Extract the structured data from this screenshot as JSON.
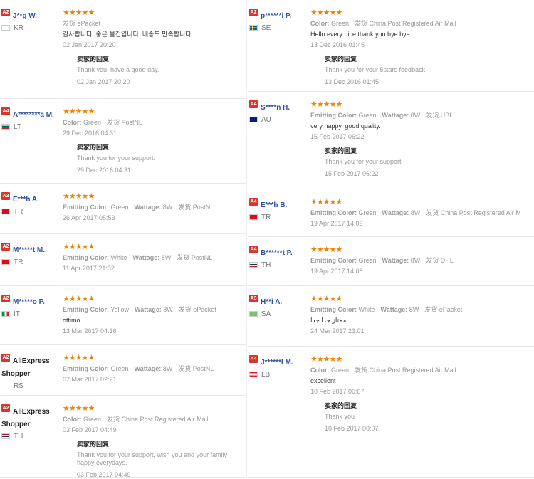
{
  "stars": "★★★★★",
  "reply_label": "卖家的回复",
  "left": [
    {
      "level": "A2",
      "name": "J**g W.",
      "country": "KR",
      "flag": "kr",
      "props": [
        {
          "k": "",
          "v": "发货 ePacket"
        }
      ],
      "text": "감사합니다. 좋은 물건입니다. 배송도 만족합니다.",
      "date": "02 Jan 2017 20:20",
      "reply": {
        "text": "Thank you, have a good day.",
        "date": "02 Jan 2017 20:20"
      }
    },
    {
      "level": "A4",
      "name": "A********a M.",
      "country": "LT",
      "flag": "lt",
      "props": [
        {
          "k": "Color:",
          "v": "Green"
        },
        {
          "k": "",
          "v": "发货 PostNL"
        }
      ],
      "text": "",
      "date": "29 Dec 2016 04:31",
      "reply": {
        "text": "Thank you for your support.",
        "date": "29 Dec 2016 04:31"
      }
    },
    {
      "level": "A2",
      "name": "E***h A.",
      "country": "TR",
      "flag": "tr",
      "props": [
        {
          "k": "Emitting Color:",
          "v": "Green"
        },
        {
          "k": "Wattage:",
          "v": "8W"
        },
        {
          "k": "",
          "v": "发货 PostNL"
        }
      ],
      "text": "",
      "date": "26 Apr 2017 05:53",
      "reply": null
    },
    {
      "level": "A2",
      "name": "M*****t M.",
      "country": "TR",
      "flag": "tr",
      "props": [
        {
          "k": "Emitting Color:",
          "v": "White"
        },
        {
          "k": "Wattage:",
          "v": "8W"
        },
        {
          "k": "",
          "v": "发货 PostNL"
        }
      ],
      "text": "",
      "date": "11 Apr 2017 21:32",
      "reply": null
    },
    {
      "level": "A2",
      "name": "M*****o P.",
      "country": "IT",
      "flag": "it",
      "props": [
        {
          "k": "Emitting Color:",
          "v": "Yellow"
        },
        {
          "k": "Wattage:",
          "v": "8W"
        },
        {
          "k": "",
          "v": "发货 ePacket"
        }
      ],
      "text": "ottimo",
      "date": "13 Mar 2017 04:16",
      "reply": null
    },
    {
      "level": "A2",
      "name": "AliExpress Shopper",
      "country": "RS",
      "flag": "",
      "props": [
        {
          "k": "Emitting Color:",
          "v": "Green"
        },
        {
          "k": "Wattage:",
          "v": "8W"
        },
        {
          "k": "",
          "v": "发货 PostNL"
        }
      ],
      "text": "",
      "date": "07 Mar 2017 02:21",
      "reply": null
    },
    {
      "level": "A2",
      "name": "AliExpress Shopper",
      "country": "TH",
      "flag": "th",
      "props": [
        {
          "k": "Color:",
          "v": "Green"
        },
        {
          "k": "",
          "v": "发货 China Post Registered Air Mail"
        }
      ],
      "text": "",
      "date": "03 Feb 2017 04:49",
      "reply": {
        "text": "Thank you for your support, wish you and your family happy everydays.",
        "date": "03 Feb 2017 04:49"
      }
    }
  ],
  "right": [
    {
      "level": "A2",
      "name": "p******i P.",
      "country": "SE",
      "flag": "se",
      "props": [
        {
          "k": "Color:",
          "v": "Green"
        },
        {
          "k": "",
          "v": "发货 China Post Registered Air Mail"
        }
      ],
      "text": "Hello every nice thank you bye bye.",
      "date": "13 Dec 2016 01:45",
      "reply": {
        "text": "Thank you for your 5stars feedback",
        "date": "13 Dec 2016 01:45"
      }
    },
    {
      "level": "A4",
      "name": "S****n H.",
      "country": "AU",
      "flag": "au",
      "props": [
        {
          "k": "Emitting Color:",
          "v": "Green"
        },
        {
          "k": "Wattage:",
          "v": "8W"
        },
        {
          "k": "",
          "v": "发货 UBI"
        }
      ],
      "text": "very happy, good quality.",
      "date": "15 Feb 2017 06:22",
      "reply": {
        "text": "Thank you for your support",
        "date": "15 Feb 2017 06:22"
      }
    },
    {
      "level": "A4",
      "name": "E***h B.",
      "country": "TR",
      "flag": "tr",
      "props": [
        {
          "k": "Emitting Color:",
          "v": "Green"
        },
        {
          "k": "Wattage:",
          "v": "8W"
        },
        {
          "k": "",
          "v": "发货 China Post Registered Air M"
        }
      ],
      "text": "",
      "date": "19 Apr 2017 14:09",
      "reply": null
    },
    {
      "level": "A4",
      "name": "B******t P.",
      "country": "TH",
      "flag": "th",
      "props": [
        {
          "k": "Emitting Color:",
          "v": "Green"
        },
        {
          "k": "Wattage:",
          "v": "8W"
        },
        {
          "k": "",
          "v": "发货 DHL"
        }
      ],
      "text": "",
      "date": "19 Apr 2017 14:08",
      "reply": null
    },
    {
      "level": "A3",
      "name": "H**i A.",
      "country": "SA",
      "flag": "sa",
      "props": [
        {
          "k": "Emitting Color:",
          "v": "White"
        },
        {
          "k": "Wattage:",
          "v": "8W"
        },
        {
          "k": "",
          "v": "发货 ePacket"
        }
      ],
      "text": "ممتاز جدا جدا",
      "date": "24 Mar 2017 23:01",
      "reply": null
    },
    {
      "level": "A4",
      "name": "J******l M.",
      "country": "LB",
      "flag": "lb",
      "props": [
        {
          "k": "Color:",
          "v": "Green"
        },
        {
          "k": "",
          "v": "发货 China Post Registered Air Mail"
        }
      ],
      "text": "excellent",
      "date": "10 Feb 2017 00:07",
      "reply": {
        "text": "Thank you",
        "date": "10 Feb 2017 00:07"
      }
    }
  ]
}
